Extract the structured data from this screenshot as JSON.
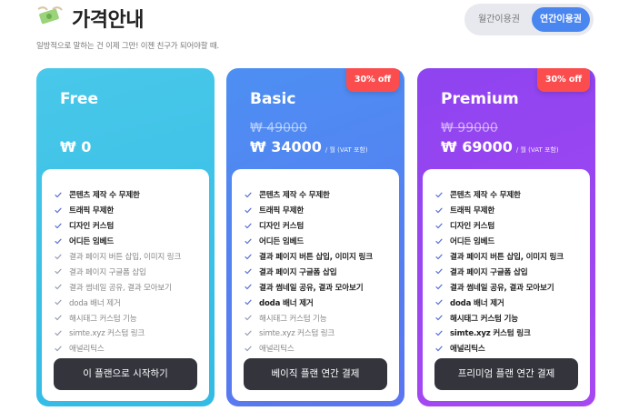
{
  "header": {
    "icon": "money-with-wings-icon",
    "title": "가격안내",
    "subtitle": "일방적으로 말하는 건 이제 그만! 이젠 친구가 되어야할 때."
  },
  "billing_toggle": {
    "monthly": "월간이용권",
    "yearly": "연간이용권",
    "selected": "yearly"
  },
  "colors": {
    "free": "#3bc1e8",
    "basic": "#5380f1",
    "premium": "#9b47f1",
    "badge": "#fb4d4d",
    "cta": "#33343c",
    "toggle_active": "#4a86f0"
  },
  "plans": [
    {
      "name": "Free",
      "price": "₩ 0",
      "cta": "이 플랜으로 시작하기",
      "features": [
        {
          "text": "콘텐츠 제작 수 무제한",
          "included": true
        },
        {
          "text": "트래픽 무제한",
          "included": true
        },
        {
          "text": "디자인 커스텀",
          "included": true
        },
        {
          "text": "어디든 임베드",
          "included": true
        },
        {
          "text": "결과 페이지 버튼 삽입, 이미지 링크",
          "included": false
        },
        {
          "text": "결과 페이지 구글폼 삽입",
          "included": false
        },
        {
          "text": "결과 썸네일 공유, 결과 모아보기",
          "included": false
        },
        {
          "text": "doda 배너 제거",
          "included": false
        },
        {
          "text": "해시태그 커스텀 기능",
          "included": false
        },
        {
          "text": "simte.xyz 커스텀 링크",
          "included": false
        },
        {
          "text": "애널리틱스",
          "included": false
        }
      ]
    },
    {
      "name": "Basic",
      "badge": "30% off",
      "old_price": "₩ 49000",
      "price": "₩ 34000",
      "price_note": "/ 월 (VAT 포함)",
      "cta": "베이직 플랜 연간 결제",
      "features": [
        {
          "text": "콘텐츠 제작 수 무제한",
          "included": true
        },
        {
          "text": "트래픽 무제한",
          "included": true
        },
        {
          "text": "디자인 커스텀",
          "included": true
        },
        {
          "text": "어디든 임베드",
          "included": true
        },
        {
          "text": "결과 페이지 버튼 삽입, 이미지 링크",
          "included": true
        },
        {
          "text": "결과 페이지 구글폼 삽입",
          "included": true
        },
        {
          "text": "결과 썸네일 공유, 결과 모아보기",
          "included": true
        },
        {
          "text": "doda 배너 제거",
          "included": true
        },
        {
          "text": "해시태그 커스텀 기능",
          "included": false
        },
        {
          "text": "simte.xyz 커스텀 링크",
          "included": false
        },
        {
          "text": "애널리틱스",
          "included": false
        }
      ]
    },
    {
      "name": "Premium",
      "badge": "30% off",
      "old_price": "₩ 99000",
      "price": "₩ 69000",
      "price_note": "/ 월 (VAT 포함)",
      "cta": "프리미엄 플랜 연간 결제",
      "features": [
        {
          "text": "콘텐츠 제작 수 무제한",
          "included": true
        },
        {
          "text": "트래픽 무제한",
          "included": true
        },
        {
          "text": "디자인 커스텀",
          "included": true
        },
        {
          "text": "어디든 임베드",
          "included": true
        },
        {
          "text": "결과 페이지 버튼 삽입, 이미지 링크",
          "included": true
        },
        {
          "text": "결과 페이지 구글폼 삽입",
          "included": true
        },
        {
          "text": "결과 썸네일 공유, 결과 모아보기",
          "included": true
        },
        {
          "text": "doda 배너 제거",
          "included": true
        },
        {
          "text": "해시태그 커스텀 기능",
          "included": true
        },
        {
          "text": "simte.xyz 커스텀 링크",
          "included": true
        },
        {
          "text": "애널리틱스",
          "included": true
        }
      ]
    }
  ]
}
